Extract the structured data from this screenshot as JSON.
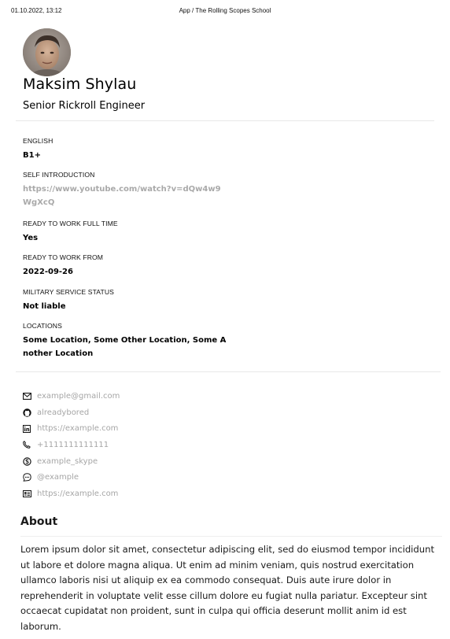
{
  "print_header": {
    "datetime": "01.10.2022, 13:12",
    "title": "App / The Rolling Scopes School"
  },
  "profile": {
    "name": "Maksim Shylau",
    "position": "Senior Rickroll Engineer"
  },
  "fields": {
    "english": {
      "label": "ENGLISH",
      "value": "B1+"
    },
    "self_intro": {
      "label": "SELF INTRODUCTION",
      "value": "https://www.youtube.com/watch?v=dQw4w9WgXcQ"
    },
    "ready_full_time": {
      "label": "READY TO WORK FULL TIME",
      "value": "Yes"
    },
    "ready_from": {
      "label": "READY TO WORK FROM",
      "value": "2022-09-26"
    },
    "military": {
      "label": "MILITARY SERVICE STATUS",
      "value": "Not liable"
    },
    "locations": {
      "label": "LOCATIONS",
      "value": "Some Location, Some Other Location, Some Another Location"
    }
  },
  "contacts": [
    {
      "icon": "mail-icon",
      "value": "example@gmail.com"
    },
    {
      "icon": "github-icon",
      "value": "alreadybored"
    },
    {
      "icon": "linkedin-icon",
      "value": "https://example.com"
    },
    {
      "icon": "phone-icon",
      "value": "+1111111111111"
    },
    {
      "icon": "skype-icon",
      "value": "example_skype"
    },
    {
      "icon": "chat-icon",
      "value": "@example"
    },
    {
      "icon": "id-card-icon",
      "value": "https://example.com"
    }
  ],
  "about": {
    "heading": "About",
    "text": "Lorem ipsum dolor sit amet, consectetur adipiscing elit, sed do eiusmod tempor incididunt ut labore et dolore magna aliqua. Ut enim ad minim veniam, quis nostrud exercitation ullamco laboris nisi ut aliquip ex ea commodo consequat. Duis aute irure dolor in reprehenderit in voluptate velit esse cillum dolore eu fugiat nulla pariatur. Excepteur sint occaecat cupidatat non proident, sunt in culpa qui officia deserunt mollit anim id est laborum."
  },
  "colors": {
    "link_gray": "#a9a9a9",
    "contact_gray": "#a6a6a6",
    "divider": "#e8e8e8"
  }
}
